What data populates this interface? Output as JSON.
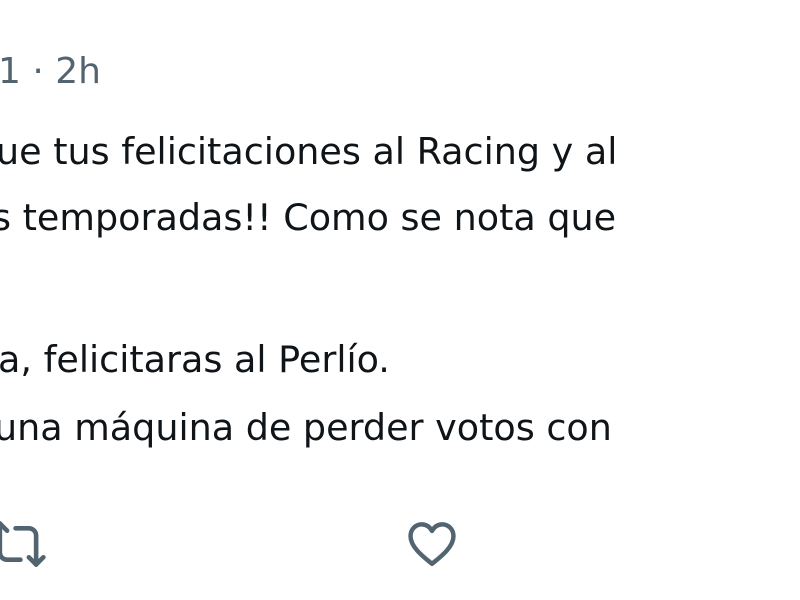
{
  "tweet": {
    "meta_text": "1 · 2h",
    "lines": [
      "ue tus felicitaciones al Racing y al",
      "s temporadas!! Como se nota que",
      "a, felicitaras al Perlío.",
      "una máquina de perder votos con"
    ]
  },
  "actions": {
    "retweet_icon": "retweet-icon",
    "like_icon": "heart-icon"
  },
  "colors": {
    "text": "#0f1419",
    "secondary": "#536471"
  }
}
